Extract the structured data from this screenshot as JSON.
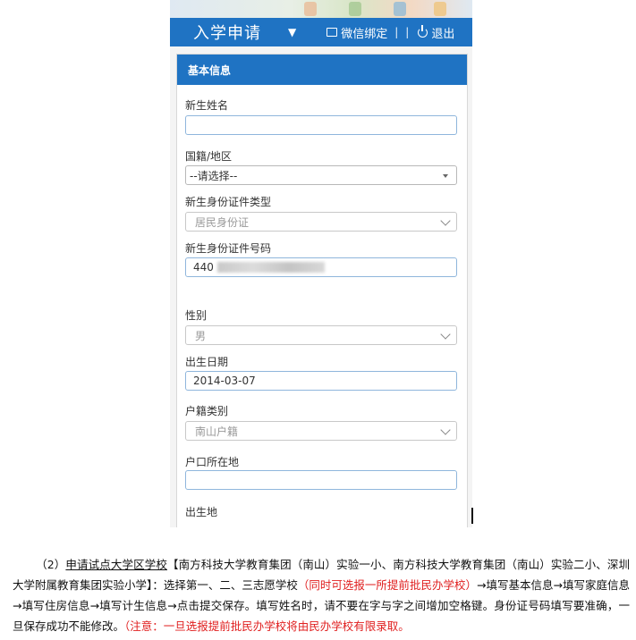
{
  "header": {
    "title": "入学申请",
    "wechat_bind": "微信绑定",
    "separator": "|",
    "logout": "退出"
  },
  "card": {
    "title": "基本信息"
  },
  "form": {
    "name_label": "新生姓名",
    "name_value": "",
    "nationality_label": "国籍/地区",
    "nationality_value": "--请选择--",
    "id_type_label": "新生身份证件类型",
    "id_type_value": "居民身份证",
    "id_number_label": "新生身份证件号码",
    "id_number_value": "440",
    "gender_label": "性别",
    "gender_value": "男",
    "birthdate_label": "出生日期",
    "birthdate_value": "2014-03-07",
    "hukou_type_label": "户籍类别",
    "hukou_type_value": "南山户籍",
    "hukou_location_label": "户口所在地",
    "hukou_location_value": "",
    "birthplace_label": "出生地"
  },
  "document": {
    "p1": "（2）",
    "p2": "申请试点大学区学校",
    "p3": "【南方科技大学教育集团（南山）实验一小、南方科技大学教育集团（南山）实验二小、深圳大学附属教育集团实验小学】：选择第一、二、三志愿学校",
    "p4": "（同时可选报一所提前批民办学校）",
    "p5": "→填写基本信息→填写家庭信息→填写住房信息→填写计生信息→点击提交保存。填写姓名时，请不要在字与字之间增加空格键。身份证号码填写要准确，一旦保存成功不能修改。",
    "p6": "（注意：一旦选报提前批民办学校将由民办学校有限录取。"
  },
  "colors": {
    "primary": "#1f73c3",
    "warning_text": "#e02020"
  }
}
